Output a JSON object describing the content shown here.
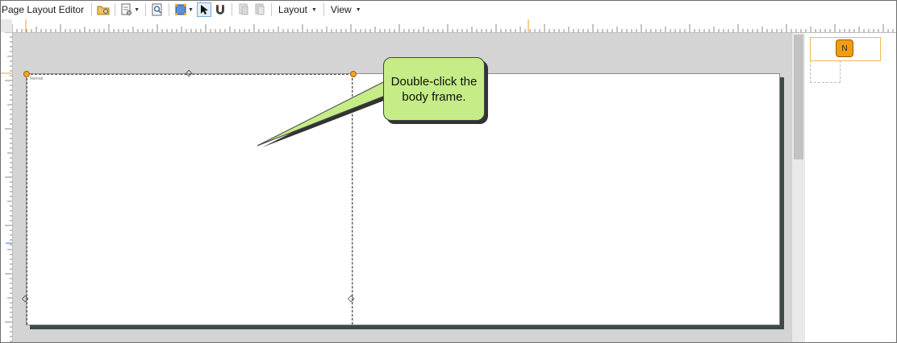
{
  "toolbar": {
    "title": "Page Layout Editor",
    "buttons": [
      {
        "name": "open-folder-icon"
      },
      {
        "name": "page-settings-icon",
        "dropdown": true
      },
      {
        "name": "preview-icon"
      },
      {
        "name": "frame-tool-icon",
        "dropdown": true
      },
      {
        "name": "pointer-icon",
        "selected": true
      },
      {
        "name": "magnet-icon"
      },
      {
        "name": "bring-forward-icon",
        "disabled": true
      },
      {
        "name": "send-backward-icon",
        "disabled": true
      }
    ],
    "layout_menu": "Layout",
    "view_menu": "View"
  },
  "page": {
    "frame_label": "Normal"
  },
  "callout": {
    "text_line1": "Double-click the",
    "text_line2": "body frame."
  },
  "side_panel": {
    "thumbnail_badge": "N"
  },
  "colors": {
    "callout_fill": "#c5ec86",
    "handle_orange": "#f5a623",
    "canvas_gray": "#d4d4d4",
    "badge_orange": "#f39c12"
  }
}
